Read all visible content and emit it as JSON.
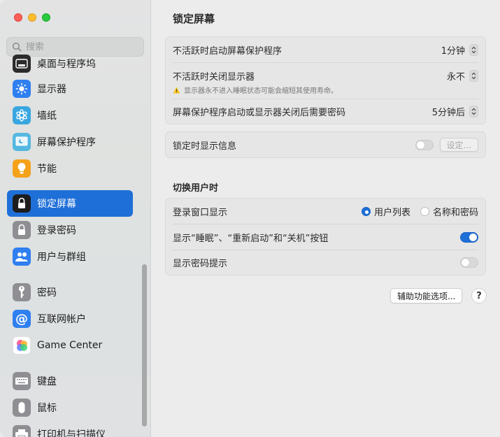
{
  "sidebar": {
    "search_placeholder": "搜索",
    "items": [
      {
        "label": "桌面与程序坞",
        "icon": "dock-icon",
        "color": "#2b2b2b"
      },
      {
        "label": "显示器",
        "icon": "sun-icon",
        "color": "#2f7ff0"
      },
      {
        "label": "墙纸",
        "icon": "flower-icon",
        "color": "#3aa6e0"
      },
      {
        "label": "屏幕保护程序",
        "icon": "screensaver-icon",
        "color": "#54b8e0"
      },
      {
        "label": "节能",
        "icon": "lightbulb-icon",
        "color": "#f4a21a"
      },
      {
        "label": "锁定屏幕",
        "icon": "lock-screen-icon",
        "color": "#1d1d1d"
      },
      {
        "label": "登录密码",
        "icon": "lock-icon",
        "color": "#8e8e93"
      },
      {
        "label": "用户与群组",
        "icon": "users-icon",
        "color": "#2f7ff0"
      },
      {
        "label": "密码",
        "icon": "key-icon",
        "color": "#8e8e93"
      },
      {
        "label": "互联网帐户",
        "icon": "at-icon",
        "color": "#2f7ff0"
      },
      {
        "label": "Game Center",
        "icon": "game-center-icon",
        "color": "#ffffff"
      },
      {
        "label": "键盘",
        "icon": "keyboard-icon",
        "color": "#8e8e93"
      },
      {
        "label": "鼠标",
        "icon": "mouse-icon",
        "color": "#8e8e93"
      },
      {
        "label": "打印机与扫描仪",
        "icon": "printer-icon",
        "color": "#8e8e93"
      }
    ]
  },
  "main": {
    "title": "锁定屏幕",
    "card1": {
      "row1": {
        "label": "不活跃时启动屏幕保护程序",
        "value": "1分钟"
      },
      "row2": {
        "label": "不活跃时关闭显示器",
        "value": "永不",
        "warning": "显示器永不进入睡眠状态可能会缩短其使用寿命。"
      },
      "row3": {
        "label": "屏幕保护程序启动或显示器关闭后需要密码",
        "value": "5分钟后"
      }
    },
    "card2": {
      "label": "锁定时显示信息",
      "button": "设定..."
    },
    "section_heading": "切换用户时",
    "card3": {
      "row1": {
        "label": "登录窗口显示",
        "option_a": "用户列表",
        "option_b": "名称和密码"
      },
      "row2": {
        "label": "显示“睡眠”、“重新启动”和“关机”按钮"
      },
      "row3": {
        "label": "显示密码提示"
      }
    },
    "accessibility_button": "辅助功能选项...",
    "help_label": "?"
  },
  "colors": {
    "accent": "#1f6fd8"
  }
}
